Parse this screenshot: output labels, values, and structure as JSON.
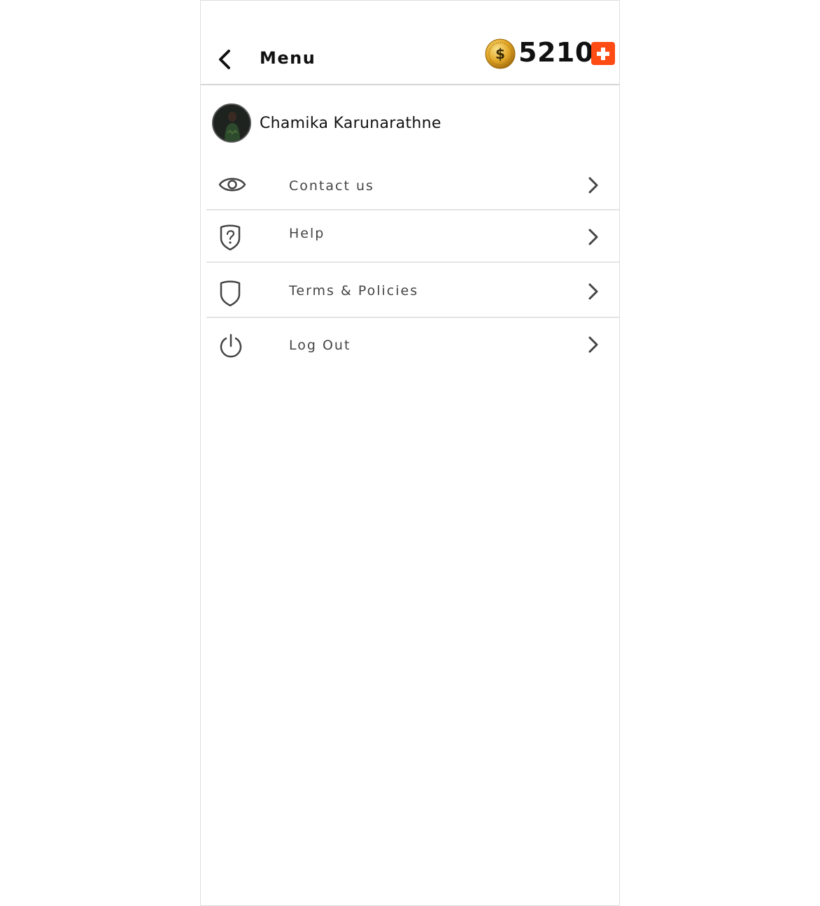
{
  "header": {
    "title": "Menu",
    "coin_count": "5210"
  },
  "colors": {
    "accent": "#ff4b14",
    "coin_gold": "#e3a829",
    "text_primary": "#111111",
    "text_menu": "#444444",
    "divider": "#e4e4e4"
  },
  "profile": {
    "name": "Chamika Karunarathne"
  },
  "menu": {
    "items": [
      {
        "label": "Contact us",
        "icon": "eye-icon"
      },
      {
        "label": "Help",
        "icon": "shield-question-icon"
      },
      {
        "label": "Terms & Policies",
        "icon": "shield-icon"
      },
      {
        "label": "Log Out",
        "icon": "power-icon"
      }
    ]
  }
}
